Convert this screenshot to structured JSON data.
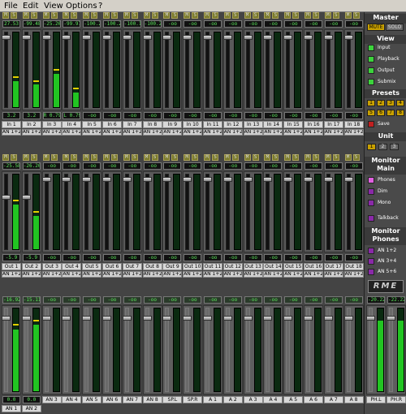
{
  "menu": {
    "file": "File",
    "edit": "Edit",
    "view": "View",
    "options": "Options",
    "help": "?"
  },
  "buttons": {
    "mute": "M",
    "solo": "S"
  },
  "inputs": {
    "levels": [
      "27.53",
      "-99.48",
      "-25.26",
      "-99.97",
      "-100.2",
      "-100.2",
      "-100.1",
      "-100.2",
      "-oo",
      "-oo",
      "-oo",
      "-oo",
      "-oo",
      "-oo",
      "-oo",
      "-oo",
      "-oo",
      "-oo"
    ],
    "meter_fill": [
      0.35,
      0.3,
      0.45,
      0.2,
      0,
      0,
      0,
      0,
      0,
      0,
      0,
      0,
      0,
      0,
      0,
      0,
      0,
      0
    ],
    "fader_pos": [
      0.95,
      0.95,
      0.95,
      0.95,
      0.95,
      0.95,
      0.95,
      0.95,
      0.95,
      0.95,
      0.95,
      0.95,
      0.95,
      0.95,
      0.95,
      0.95,
      0.95,
      0.95
    ],
    "gains": [
      "3.2",
      "3.2",
      "R 0.79",
      "L 0.79",
      "-oo",
      "-oo",
      "-oo",
      "-oo",
      "-oo",
      "-oo",
      "-oo",
      "-oo",
      "-oo",
      "-oo",
      "-oo",
      "-oo",
      "-oo",
      "-oo"
    ],
    "names": [
      "In 1",
      "In 2",
      "In 3",
      "In 4",
      "In 5",
      "In 6",
      "In 7",
      "In 8",
      "In 9",
      "In 10",
      "In 11",
      "In 12",
      "In 13",
      "In 14",
      "In 15",
      "In 16",
      "In 17",
      "In 18"
    ],
    "routing": [
      "AN 1+2",
      "AN 1+2",
      "AN 1+2",
      "AN 1+2",
      "AN 1+2",
      "AN 1+2",
      "AN 1+2",
      "AN 1+2",
      "AN 1+2",
      "AN 1+2",
      "AN 1+2",
      "AN 1+2",
      "AN 1+2",
      "AN 1+2",
      "AN 1+2",
      "AN 1+2",
      "AN 1+2",
      "AN 1+2"
    ]
  },
  "playback": {
    "levels": [
      "-25.58",
      "-26.26",
      "-oo",
      "-oo",
      "-oo",
      "-oo",
      "-oo",
      "-oo",
      "-oo",
      "-oo",
      "-oo",
      "-oo",
      "-oo",
      "-oo",
      "-oo",
      "-oo",
      "-oo",
      "-oo"
    ],
    "meter_fill": [
      0.6,
      0.45,
      0,
      0,
      0,
      0,
      0,
      0,
      0,
      0,
      0,
      0,
      0,
      0,
      0,
      0,
      0,
      0
    ],
    "fader_pos": [
      0.7,
      0.7,
      0.95,
      0.95,
      0.95,
      0.95,
      0.95,
      0.95,
      0.95,
      0.95,
      0.95,
      0.95,
      0.95,
      0.95,
      0.95,
      0.95,
      0.95,
      0.95
    ],
    "gains": [
      "-5.9",
      "-5.9",
      "-oo",
      "-oo",
      "-oo",
      "-oo",
      "-oo",
      "-oo",
      "-oo",
      "-oo",
      "-oo",
      "-oo",
      "-oo",
      "-oo",
      "-oo",
      "-oo",
      "-oo",
      "-oo"
    ],
    "names": [
      "Out 1",
      "Out 2",
      "Out 3",
      "Out 4",
      "Out 5",
      "Out 6",
      "Out 7",
      "Out 8",
      "Out 9",
      "Out 10",
      "Out 11",
      "Out 12",
      "Out 13",
      "Out 14",
      "Out 15",
      "Out 16",
      "Out 17",
      "Out 18"
    ],
    "routing": [
      "AN 1+2",
      "AN 1+2",
      "AN 1+2",
      "AN 1+2",
      "AN 1+2",
      "AN 1+2",
      "AN 1+2",
      "AN 1+2",
      "AN 1+2",
      "AN 1+2",
      "AN 1+2",
      "AN 1+2",
      "AN 1+2",
      "AN 1+2",
      "AN 1+2",
      "AN 1+2",
      "AN 1+2",
      "AN 1+2"
    ]
  },
  "outputs": {
    "levels": [
      "-16.92",
      "-15.11",
      "-oo",
      "-oo",
      "-oo",
      "-oo",
      "-oo",
      "-oo",
      "-oo",
      "-oo",
      "-oo",
      "-oo",
      "-oo",
      "-oo",
      "-oo",
      "-oo",
      "-oo",
      "-oo",
      "-20.22",
      "-22.22"
    ],
    "meter_fill": [
      0.75,
      0.8,
      0,
      0,
      0,
      0,
      0,
      0,
      0,
      0,
      0,
      0,
      0,
      0,
      0,
      0,
      0,
      0,
      0.85,
      0.85
    ],
    "fader_pos": [
      0.9,
      0.9,
      0.9,
      0.9,
      0.9,
      0.9,
      0.9,
      0.9,
      0.9,
      0.9,
      0.9,
      0.9,
      0.9,
      0.9,
      0.9,
      0.9,
      0.9,
      0.9,
      0.9,
      0.9
    ],
    "names": [
      "AN 1",
      "AN 2",
      "AN 3",
      "AN 4",
      "AN 5",
      "AN 6",
      "AN 7",
      "AN 8",
      "SP.L",
      "SP.R",
      "A 1",
      "A 2",
      "A 3",
      "A 4",
      "A 5",
      "A 6",
      "A 7",
      "A 8",
      "PH.L",
      "PH.R"
    ],
    "gains": [
      "0.0",
      "0.0"
    ]
  },
  "panel": {
    "master_title": "Master",
    "mute": "MUTE",
    "solo": "SOLO",
    "view_title": "View",
    "view_items": [
      "Input",
      "Playback",
      "Output",
      "Submix"
    ],
    "presets_title": "Presets",
    "preset_numbers": [
      "1",
      "2",
      "3",
      "4",
      "5",
      "6",
      "7",
      "8"
    ],
    "save": "Save",
    "unit_title": "Unit",
    "unit_numbers": [
      "1",
      "2",
      "3"
    ],
    "monitor_main_title": "Monitor Main",
    "monitor_main_items": [
      "Phones",
      "Dim",
      "Mono",
      "Talkback"
    ],
    "monitor_phones_title": "Monitor Phones",
    "monitor_phones_items": [
      "AN 1+2",
      "AN 3+4",
      "AN 5+6"
    ],
    "logo": "RME"
  },
  "colors": {
    "green": "#22c422",
    "yellow": "#e2d000",
    "purple": "#8a2aa8",
    "led_green": "#3cd33c"
  }
}
